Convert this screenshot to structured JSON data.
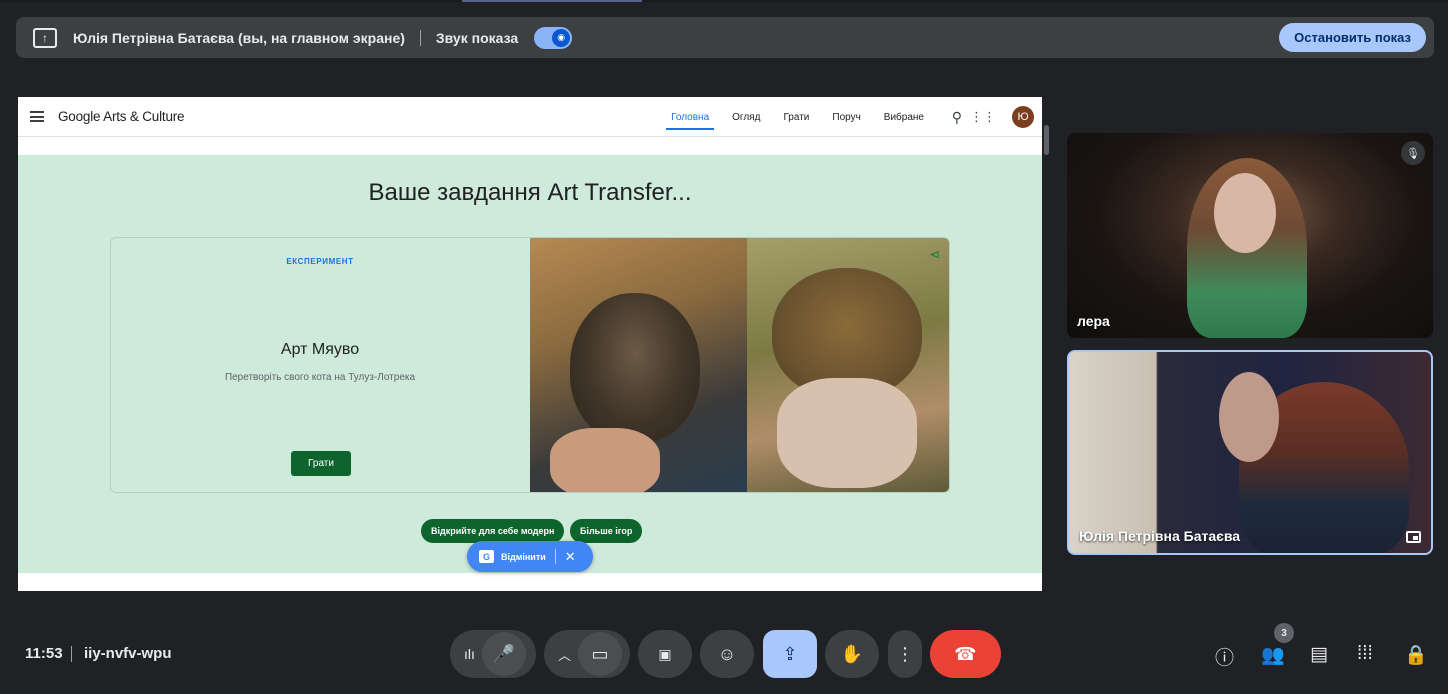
{
  "present_bar": {
    "presenter": "Юлія Петрівна Батаєва (вы, на главном экране)",
    "sound_label": "Звук показа",
    "stop_label": "Остановить показ"
  },
  "shared_page": {
    "logo": "Google Arts & Culture",
    "nav": [
      "Головна",
      "Огляд",
      "Грати",
      "Поруч",
      "Вибране"
    ],
    "avatar_letter": "Ю",
    "heading": "Ваше завдання Art Transfer...",
    "card": {
      "kicker": "ЕКСПЕРИМЕНТ",
      "title": "Арт Мяуво",
      "subtitle": "Перетворіть свого кота на Тулуз-Лотрека",
      "play_label": "Грати"
    },
    "chips": [
      "Відкрийте для себе модерн",
      "Більше ігор"
    ],
    "translate_label": "Відмінити"
  },
  "participants": [
    {
      "name": "лера",
      "muted": true
    },
    {
      "name": "Юлія Петрівна Батаєва",
      "muted": false
    }
  ],
  "meeting": {
    "time": "11:53",
    "code": "iiy-nvfv-wpu",
    "participant_count": "3"
  },
  "colors": {
    "accent": "#a8c7fa",
    "end_call": "#ea4335",
    "page_bg": "#ceeadb",
    "play_green": "#0d652d"
  }
}
